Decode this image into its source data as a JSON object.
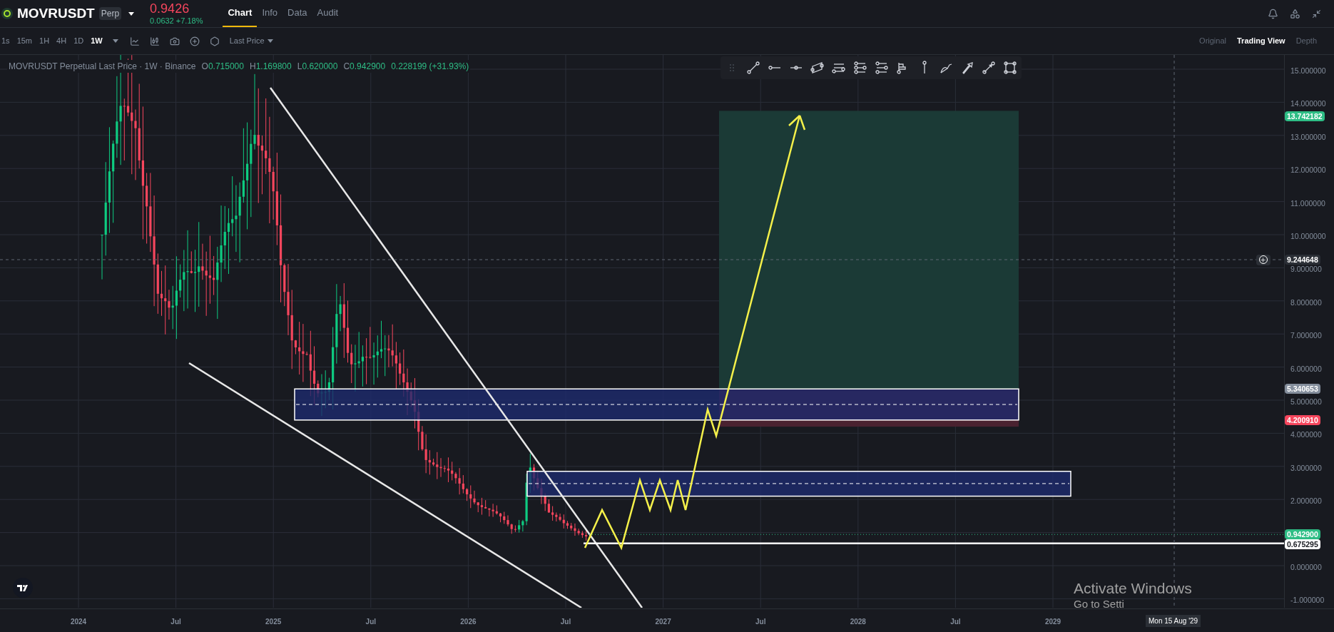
{
  "header": {
    "symbol": "MOVRUSDT",
    "badge": "Perp",
    "price": "0.9426",
    "change": "0.0632 +7.18%"
  },
  "tabs": [
    {
      "label": "Chart",
      "selected": true
    },
    {
      "label": "Info",
      "selected": false
    },
    {
      "label": "Data",
      "selected": false
    },
    {
      "label": "Audit",
      "selected": false
    }
  ],
  "intervals": [
    {
      "label": "1s",
      "selected": false
    },
    {
      "label": "15m",
      "selected": false
    },
    {
      "label": "1H",
      "selected": false
    },
    {
      "label": "4H",
      "selected": false
    },
    {
      "label": "1D",
      "selected": false
    },
    {
      "label": "1W",
      "selected": true
    }
  ],
  "price_source": "Last Price",
  "views": [
    {
      "label": "Original",
      "selected": false
    },
    {
      "label": "Trading View",
      "selected": true
    },
    {
      "label": "Depth",
      "selected": false
    }
  ],
  "chart": {
    "legend": {
      "title": "MOVRUSDT Perpetual Last Price · 1W · Binance",
      "ohlc": [
        {
          "key": "O",
          "value": "0.715000"
        },
        {
          "key": "H",
          "value": "1.169800"
        },
        {
          "key": "L",
          "value": "0.620000"
        },
        {
          "key": "C",
          "value": "0.942900"
        }
      ],
      "change": "0.228199 (+31.93%)"
    },
    "price_axis": [
      "15.000000",
      "14.000000",
      "13.000000",
      "12.000000",
      "11.000000",
      "10.000000",
      "9.000000",
      "8.000000",
      "7.000000",
      "6.000000",
      "5.000000",
      "4.000000",
      "3.000000",
      "2.000000",
      "0.000000",
      "-1.000000"
    ],
    "time_axis": [
      "2024",
      "Jul",
      "2025",
      "Jul",
      "2026",
      "Jul",
      "2027",
      "Jul",
      "2028",
      "Jul",
      "2029"
    ],
    "price_labels": [
      {
        "text": "13.742182",
        "color": "#2ebd85",
        "kind": "marker"
      },
      {
        "text": "9.244648",
        "color": "#2b2f36",
        "kind": "crosshair"
      },
      {
        "text": "5.340653",
        "color": "#848e9c",
        "kind": "marker"
      },
      {
        "text": "4.200910",
        "color": "#f6465d",
        "kind": "marker"
      },
      {
        "text": "0.942900",
        "color": "#2ebd85",
        "kind": "marker"
      },
      {
        "text": "0.675295",
        "color": "#ffffff",
        "kind": "marker"
      }
    ],
    "crosshair_date": "Mon 15 Aug '29"
  },
  "os_notice": {
    "title": "Activate Windows",
    "text": "Go to Setti"
  }
}
